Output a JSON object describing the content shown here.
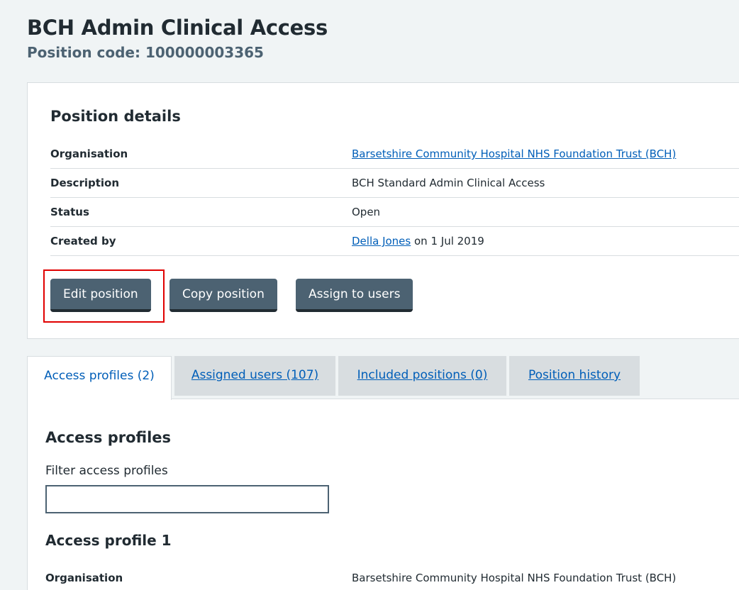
{
  "header": {
    "title": "BCH Admin Clinical Access",
    "subtitle": "Position code: 100000003365"
  },
  "details": {
    "heading": "Position details",
    "rows": [
      {
        "key": "Organisation",
        "value": "Barsetshire Community Hospital NHS Foundation Trust (BCH)"
      },
      {
        "key": "Description",
        "value": "BCH Standard Admin Clinical Access"
      },
      {
        "key": "Status",
        "value": "Open"
      },
      {
        "key": "Created by",
        "value": "Della Jones",
        "suffix": " on 1 Jul 2019"
      }
    ]
  },
  "actions": {
    "edit_label": "Edit position",
    "copy_label": "Copy position",
    "assign_label": "Assign to users"
  },
  "tabs": [
    {
      "label": "Access profiles (2)"
    },
    {
      "label": "Assigned users (107)"
    },
    {
      "label": "Included positions (0)"
    },
    {
      "label": "Position history"
    }
  ],
  "panel": {
    "heading": "Access profiles",
    "filter_label": "Filter access profiles",
    "filter_value": "",
    "profile_heading": "Access profile 1",
    "profile_org_key": "Organisation",
    "profile_org_value": "Barsetshire Community Hospital NHS Foundation Trust (BCH)"
  },
  "colors": {
    "button": "#4c6272",
    "link": "#005eb8",
    "highlight": "#e00000",
    "background": "#f0f4f5"
  }
}
